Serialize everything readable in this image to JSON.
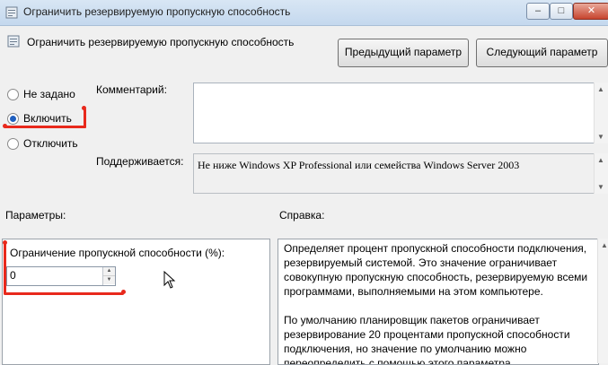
{
  "window": {
    "title": "Ограничить резервируемую пропускную способность",
    "controls": {
      "minimize": "–",
      "maximize": "□",
      "close": "✕"
    }
  },
  "header": {
    "title": "Ограничить резервируемую пропускную способность",
    "icon": "policy-icon"
  },
  "nav": {
    "prev_label": "Предыдущий параметр",
    "next_label": "Следующий параметр"
  },
  "state": {
    "options": [
      {
        "label": "Не задано",
        "checked": false
      },
      {
        "label": "Включить",
        "checked": true
      },
      {
        "label": "Отключить",
        "checked": false
      }
    ]
  },
  "comment": {
    "label": "Комментарий:",
    "value": ""
  },
  "supported": {
    "label": "Поддерживается:",
    "value": "Не ниже Windows XP Professional или семейства Windows Server 2003"
  },
  "params": {
    "title": "Параметры:",
    "limit_label": "Ограничение пропускной способности (%):",
    "limit_value": "0"
  },
  "help": {
    "title": "Справка:",
    "p1": "Определяет процент пропускной способности подключения, резервируемый системой. Это значение ограничивает совокупную пропускную способность, резервируемую всеми программами, выполняемыми на этом компьютере.",
    "p2": "По умолчанию планировщик пакетов ограничивает резервирование 20 процентами пропускной способности подключения, но значение по умолчанию можно переопределить с помощью этого параметра."
  },
  "colors": {
    "annotation": "#e8291c",
    "radio_checked": "#1f5fbf"
  }
}
